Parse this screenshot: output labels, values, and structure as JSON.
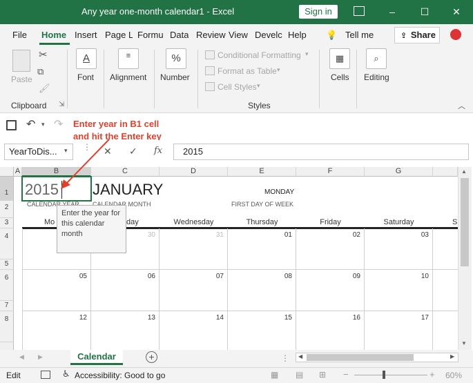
{
  "window": {
    "title": "Any year one-month calendar1  -  Excel",
    "signin": "Sign in",
    "minimize": "–",
    "restore": "☐",
    "close": "✕"
  },
  "tabs": [
    "File",
    "Home",
    "Insert",
    "Page L",
    "Formu",
    "Data",
    "Review",
    "View",
    "Develc",
    "Help"
  ],
  "tellme": "Tell me",
  "share": "Share",
  "ribbon": {
    "paste": "Paste",
    "clipboard": "Clipboard",
    "font": "Font",
    "alignment": "Alignment",
    "number": "Number",
    "conditional_formatting": "Conditional Formatting",
    "format_as_table": "Format as Table",
    "cell_styles": "Cell Styles",
    "styles": "Styles",
    "cells": "Cells",
    "editing": "Editing",
    "font_icon": "A",
    "number_icon": "%"
  },
  "annotation": {
    "line1": "Enter year in B1 cell",
    "line2": "and hit the Enter key"
  },
  "namebox": "YearToDis...",
  "formula_value": "2015",
  "fx": "fx",
  "columns": [
    "A",
    "B",
    "C",
    "D",
    "E",
    "F",
    "G"
  ],
  "rows": [
    "1",
    "2",
    "3",
    "4",
    "5",
    "6",
    "7",
    "8"
  ],
  "sheet": {
    "year": "2015",
    "month": "JANUARY",
    "first_day_value": "MONDAY",
    "year_caption": "CALENDAR YEAR",
    "month_caption": "CALENDAR MONTH",
    "first_day_caption": "FIRST DAY OF WEEK",
    "days": [
      "Monday",
      "Tuesday",
      "Wednesday",
      "Thursday",
      "Friday",
      "Saturday",
      "S"
    ],
    "days_visible": [
      "Mo",
      "day",
      "Wednesday",
      "Thursday",
      "Friday",
      "Saturday",
      "S"
    ],
    "week1": [
      "",
      "",
      "30",
      "31",
      "01",
      "02",
      "03"
    ],
    "week2": [
      "05",
      "06",
      "07",
      "08",
      "09",
      "10",
      "11"
    ],
    "week3": [
      "12",
      "13",
      "14",
      "15",
      "16",
      "17",
      "18"
    ]
  },
  "tooltip": "Enter the year for this calendar month",
  "sheet_tab": "Calendar",
  "status": {
    "mode": "Edit",
    "accessibility": "Accessibility: Good to go",
    "zoom": "60%"
  }
}
